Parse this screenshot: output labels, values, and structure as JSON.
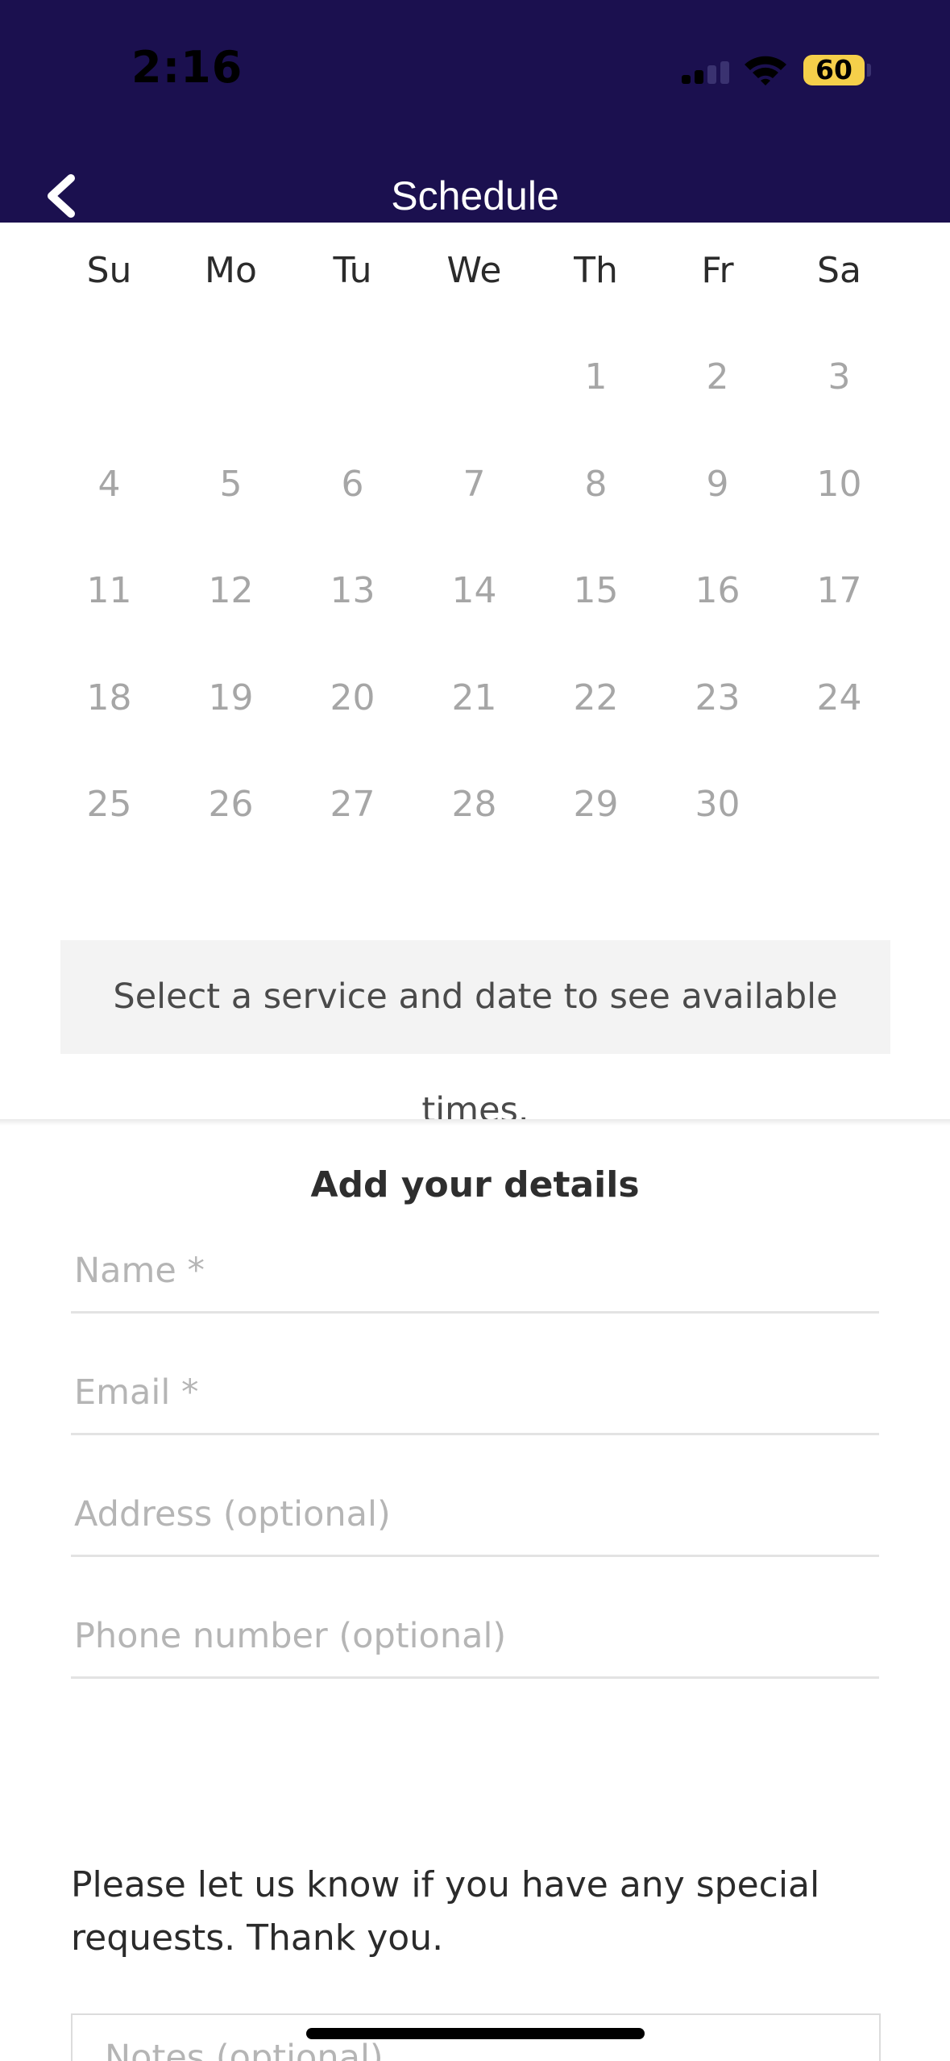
{
  "status_bar": {
    "time": "2:16",
    "battery": "60"
  },
  "header": {
    "title": "Schedule",
    "back_icon": "chevron-left-icon",
    "background": "#1b104f"
  },
  "calendar": {
    "weekdays": [
      "Su",
      "Mo",
      "Tu",
      "We",
      "Th",
      "Fr",
      "Sa"
    ],
    "days": [
      "",
      "",
      "",
      "",
      "1",
      "2",
      "3",
      "4",
      "5",
      "6",
      "7",
      "8",
      "9",
      "10",
      "11",
      "12",
      "13",
      "14",
      "15",
      "16",
      "17",
      "18",
      "19",
      "20",
      "21",
      "22",
      "23",
      "24",
      "25",
      "26",
      "27",
      "28",
      "29",
      "30",
      ""
    ]
  },
  "availability_notice": "Select a service and date to see available times.",
  "details": {
    "title": "Add your details",
    "name_placeholder": "Name *",
    "email_placeholder": "Email *",
    "address_placeholder": "Address (optional)",
    "phone_placeholder": "Phone number (optional)",
    "requests_text": "Please let us know if you have any special requests. Thank you.",
    "notes_placeholder": "Notes (optional)"
  }
}
